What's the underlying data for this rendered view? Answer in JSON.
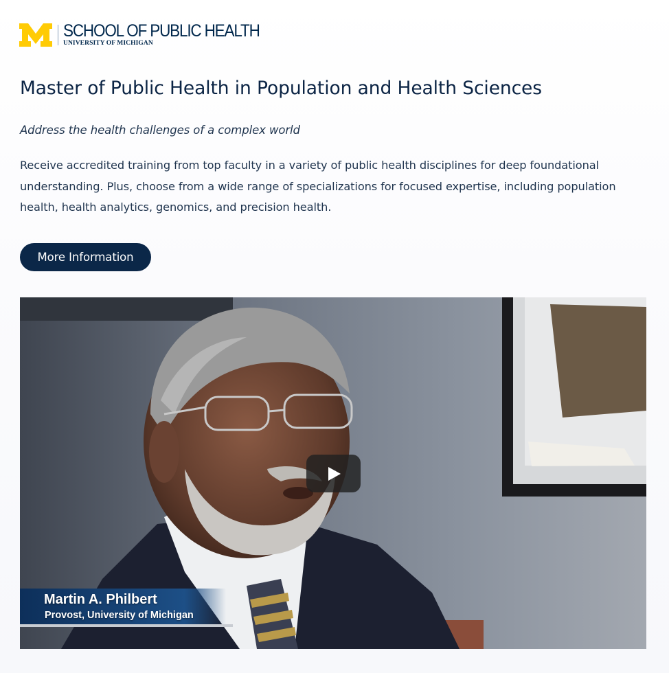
{
  "header": {
    "logo_main": "SCHOOL OF PUBLIC HEALTH",
    "logo_sub": "UNIVERSITY OF MICHIGAN",
    "logo_mark_color": "#ffcb05",
    "brand_color": "#00274c"
  },
  "main": {
    "title": "Master of Public Health in Population and Health Sciences",
    "subtitle": "Address the health challenges of a complex world",
    "description": "Receive accredited training from top faculty in a variety of public health disciplines for deep foundational understanding. Plus, choose from a wide range of specializations for focused expertise, including population health, health analytics, genomics, and precision health.",
    "cta_label": "More Information"
  },
  "video": {
    "play_icon": "play-icon",
    "lower_third": {
      "name": "Martin A. Philbert",
      "role": "Provost, University of Michigan"
    }
  }
}
